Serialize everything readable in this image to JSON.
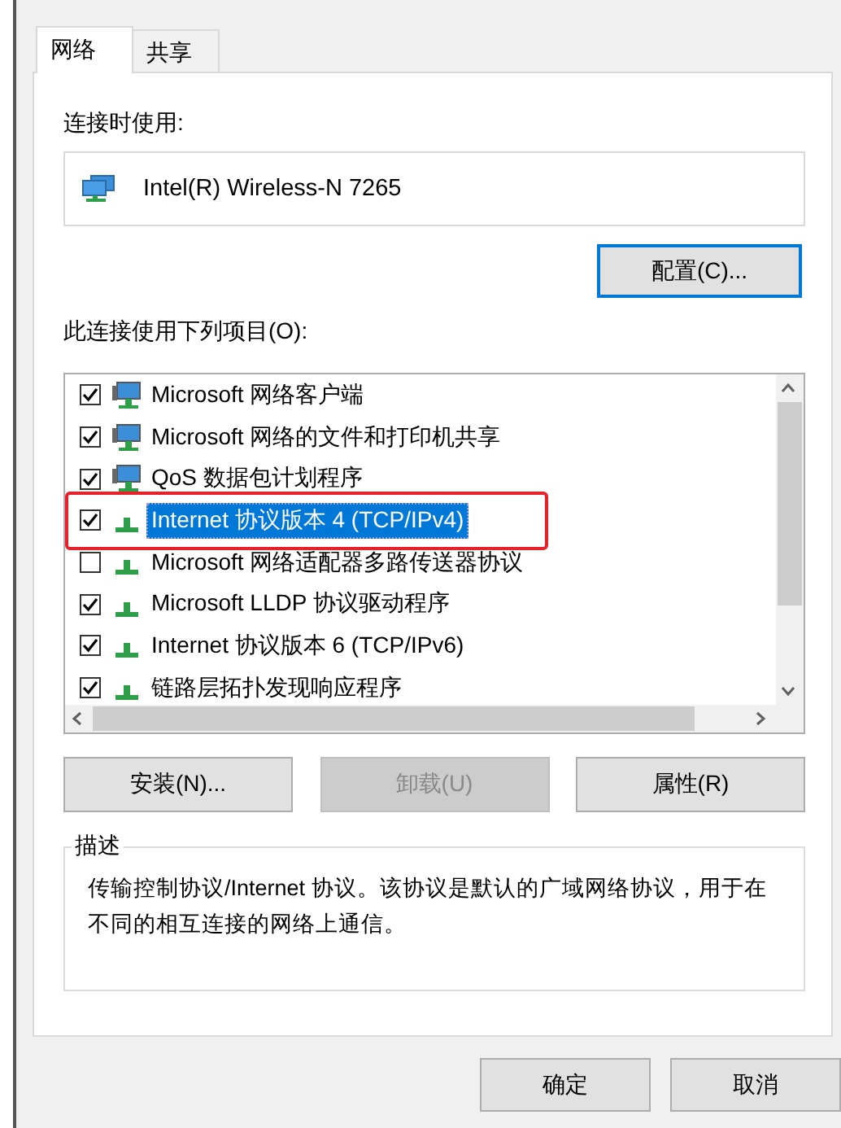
{
  "tabs": [
    {
      "label": "网络",
      "selected": true
    },
    {
      "label": "共享",
      "selected": false
    }
  ],
  "connect_using": {
    "label": "连接时使用:",
    "adapter": "Intel(R) Wireless-N 7265",
    "configure_button": "配置(C)..."
  },
  "items_label": "此连接使用下列项目(O):",
  "items": [
    {
      "kind": "client",
      "label": "Microsoft 网络客户端",
      "checked": true,
      "selected": false,
      "highlighted": false
    },
    {
      "kind": "client",
      "label": "Microsoft 网络的文件和打印机共享",
      "checked": true,
      "selected": false,
      "highlighted": false
    },
    {
      "kind": "client",
      "label": "QoS 数据包计划程序",
      "checked": true,
      "selected": false,
      "highlighted": false
    },
    {
      "kind": "protocol",
      "label": "Internet 协议版本 4 (TCP/IPv4)",
      "checked": true,
      "selected": true,
      "highlighted": true
    },
    {
      "kind": "protocol",
      "label": "Microsoft 网络适配器多路传送器协议",
      "checked": false,
      "selected": false,
      "highlighted": false
    },
    {
      "kind": "protocol",
      "label": "Microsoft LLDP 协议驱动程序",
      "checked": true,
      "selected": false,
      "highlighted": false
    },
    {
      "kind": "protocol",
      "label": "Internet 协议版本 6 (TCP/IPv6)",
      "checked": true,
      "selected": false,
      "highlighted": false
    },
    {
      "kind": "protocol",
      "label": "链路层拓扑发现响应程序",
      "checked": true,
      "selected": false,
      "highlighted": false
    }
  ],
  "item_buttons": [
    {
      "label": "安装(N)...",
      "disabled": false
    },
    {
      "label": "卸载(U)",
      "disabled": true
    },
    {
      "label": "属性(R)",
      "disabled": false
    }
  ],
  "description": {
    "legend": "描述",
    "text": "传输控制协议/Internet 协议。该协议是默认的广域网络协议，用于在不同的相互连接的网络上通信。"
  },
  "dialog_buttons": [
    "确定",
    "取消"
  ]
}
